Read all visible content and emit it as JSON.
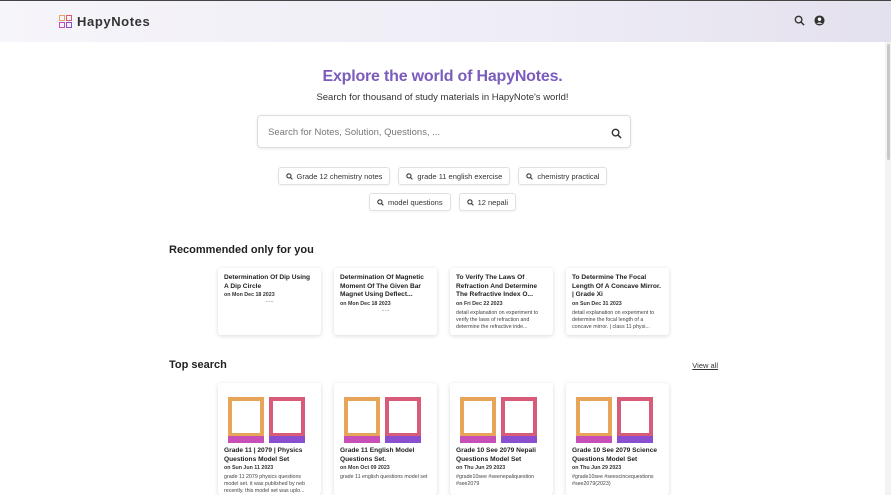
{
  "header": {
    "brand": "HapyNotes",
    "search_icon": "search-icon",
    "account_icon": "user-circle-icon"
  },
  "hero": {
    "title": "Explore the world of HapyNotes.",
    "subtitle": "Search for thousand of study materials in HapyNote's world!"
  },
  "search": {
    "placeholder": "Search for Notes, Solution, Questions, ...",
    "value": ""
  },
  "chips": [
    "Grade 12 chemistry notes",
    "grade 11 english exercise",
    "chemistry practical",
    "model questions",
    "12 nepali"
  ],
  "recommended": {
    "title": "Recommended only for you",
    "cards": [
      {
        "title": "Determination Of Dip Using A Dip Circle",
        "date": "on Mon Dec 18 2023",
        "desc": "....."
      },
      {
        "title": "Determination Of Magnetic Moment Of The Given Bar Magnet Using Deflect...",
        "date": "on Mon Dec 18 2023",
        "desc": "....."
      },
      {
        "title": "To Verify The Laws Of Refraction And Determine The Refractive Index O...",
        "date": "on Fri Dec 22 2023",
        "desc": "detail explanation on experiment to verify the laws of refraction and determine the refractive inde..."
      },
      {
        "title": "To Determine The Focal Length Of A Concave Mirror. | Grade Xi",
        "date": "on Sun Dec 31 2023",
        "desc": "detail explanation on experiment to determine the focal length of a concave mirror. | class 11 physi..."
      }
    ]
  },
  "top_search": {
    "title": "Top search",
    "view_all": "View all",
    "cards": [
      {
        "title": "Grade 11 | 2079 | Physics Questions Model Set",
        "date": "on Sun Jun 11 2023",
        "desc": "grade 11 2079 physics questions model set. it was published by neb recently. this model set was uplo..."
      },
      {
        "title": "Grade 11 English Model Questions Set.",
        "date": "on Mon Oct 09 2023",
        "desc": "grade 11 english questions model set"
      },
      {
        "title": "Grade 10 See 2079 Nepali Questions Model Set",
        "date": "on Thu Jun 29 2023",
        "desc": "#grade10see #seenepaliquestion #see2079"
      },
      {
        "title": "Grade 10 See 2079 Science Questions Model Set",
        "date": "on Thu Jun 29 2023",
        "desc": "#grade10see #seescincequestions #see2079(2023)"
      }
    ]
  },
  "colors": {
    "accent": "#7b5cbc",
    "logo_orange": "#e8a55a",
    "logo_pink": "#d95b7a",
    "logo_magenta": "#c84fb8",
    "logo_purple": "#8a4fd0"
  }
}
